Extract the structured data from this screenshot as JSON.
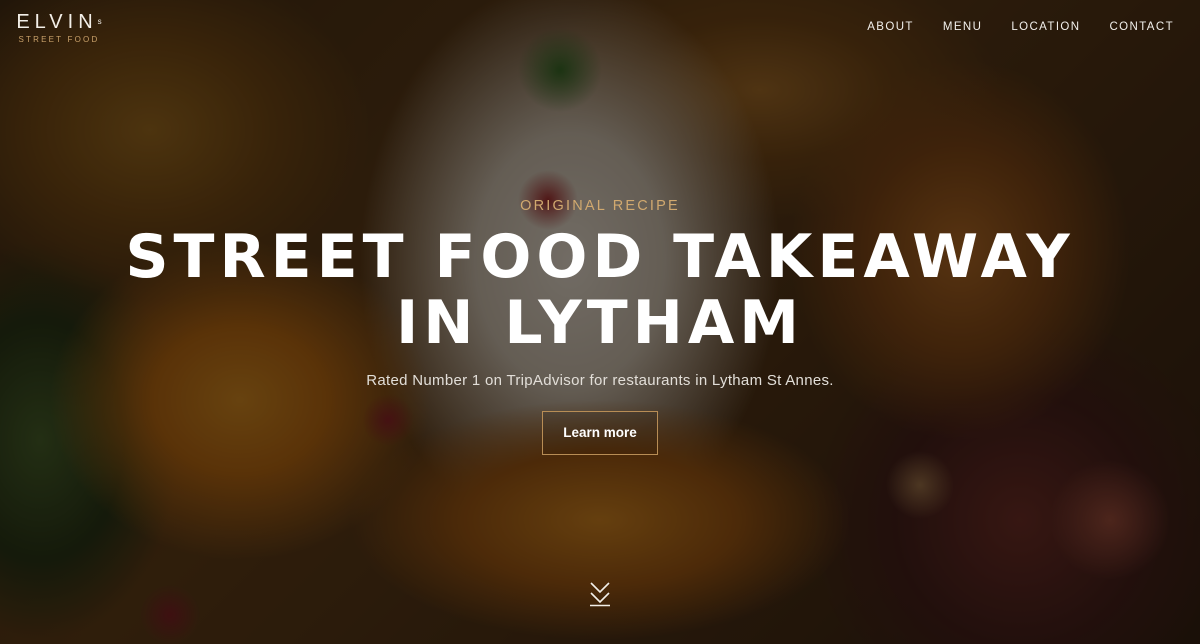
{
  "brand": {
    "name": "ELVIN",
    "superscript": "s",
    "tagline": "STREET FOOD"
  },
  "nav": {
    "items": [
      {
        "label": "ABOUT"
      },
      {
        "label": "MENU"
      },
      {
        "label": "LOCATION"
      },
      {
        "label": "CONTACT"
      }
    ]
  },
  "hero": {
    "eyebrow": "ORIGINAL RECIPE",
    "title_line1": "STREET FOOD TAKEAWAY",
    "title_line2": "IN LYTHAM",
    "subtitle": "Rated Number 1 on TripAdvisor for restaurants in Lytham St Annes.",
    "cta_label": "Learn more",
    "scroll_icon": "double-chevron-down-icon"
  },
  "colors": {
    "accent_gold": "#b88d55",
    "eyebrow_gold": "#d1a96f",
    "text_white": "#ffffff"
  }
}
